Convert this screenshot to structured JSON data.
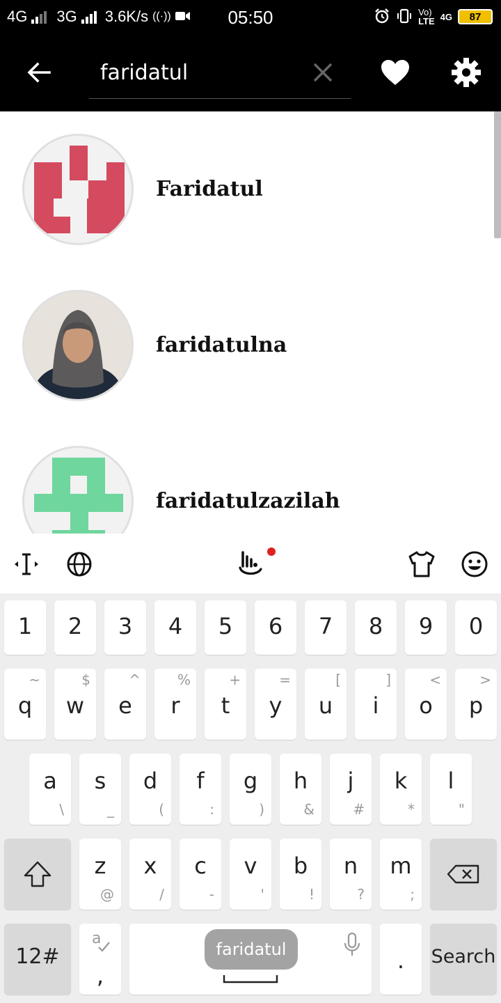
{
  "status_bar": {
    "network_1": "4G",
    "network_2": "3G",
    "speed": "3.6K/s",
    "time": "05:50",
    "volte_top": "Vo)",
    "volte_bottom": "LTE",
    "lte_label": "4G",
    "battery": "87",
    "icons": [
      "signal-icon",
      "signal-icon",
      "hotspot-icon",
      "video-icon",
      "alarm-icon",
      "vibrate-icon",
      "battery-icon"
    ]
  },
  "app_bar": {
    "search_value": "faridatul",
    "icons": [
      "back-arrow-icon",
      "clear-icon",
      "heart-icon",
      "gear-icon"
    ]
  },
  "results": [
    {
      "username": "Faridatul",
      "avatar": "red-identicon"
    },
    {
      "username": "faridatulna",
      "avatar": "photo"
    },
    {
      "username": "faridatulzazilah",
      "avatar": "green-identicon"
    }
  ],
  "colors": {
    "identicon_red": "#d44a5e",
    "identicon_green": "#6fd69d",
    "notification_dot": "#e02020"
  },
  "keyboard": {
    "toolbar_icons": [
      "cursor-icon",
      "globe-icon",
      "gesture-hand-icon",
      "theme-shirt-icon",
      "emoji-icon"
    ],
    "numbers": [
      "1",
      "2",
      "3",
      "4",
      "5",
      "6",
      "7",
      "8",
      "9",
      "0"
    ],
    "row_q": [
      {
        "k": "q",
        "a": "~"
      },
      {
        "k": "w",
        "a": "$"
      },
      {
        "k": "e",
        "a": "^"
      },
      {
        "k": "r",
        "a": "%"
      },
      {
        "k": "t",
        "a": "+"
      },
      {
        "k": "y",
        "a": "="
      },
      {
        "k": "u",
        "a": "["
      },
      {
        "k": "i",
        "a": "]"
      },
      {
        "k": "o",
        "a": "<"
      },
      {
        "k": "p",
        "a": ">"
      }
    ],
    "row_a": [
      {
        "k": "a",
        "a": "\\"
      },
      {
        "k": "s",
        "a": "_"
      },
      {
        "k": "d",
        "a": "("
      },
      {
        "k": "f",
        "a": ":"
      },
      {
        "k": "g",
        "a": ")"
      },
      {
        "k": "h",
        "a": "&"
      },
      {
        "k": "j",
        "a": "#"
      },
      {
        "k": "k",
        "a": "*"
      },
      {
        "k": "l",
        "a": "\""
      }
    ],
    "row_z": [
      {
        "k": "z",
        "a": "@"
      },
      {
        "k": "x",
        "a": "/"
      },
      {
        "k": "c",
        "a": "-"
      },
      {
        "k": "v",
        "a": "'"
      },
      {
        "k": "b",
        "a": "!"
      },
      {
        "k": "n",
        "a": "?"
      },
      {
        "k": "m",
        "a": ";"
      }
    ],
    "symbols_key": "12#",
    "comma_key": ",",
    "space_suggestion": "faridatul",
    "period_key": ".",
    "action_key": "Search"
  }
}
